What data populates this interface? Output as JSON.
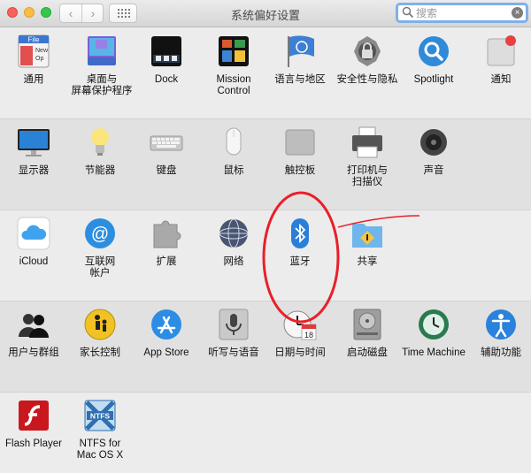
{
  "window": {
    "title": "系统偏好设置"
  },
  "toolbar": {
    "back": "‹",
    "forward": "›"
  },
  "search": {
    "placeholder": "搜索",
    "clear": "×"
  },
  "sections": [
    {
      "items": [
        {
          "label": "通用",
          "icon": "general-icon"
        },
        {
          "label": "桌面与\n屏幕保护程序",
          "icon": "desktop-screensaver-icon"
        },
        {
          "label": "Dock",
          "icon": "dock-icon"
        },
        {
          "label": "Mission\nControl",
          "icon": "mission-control-icon"
        },
        {
          "label": "语言与地区",
          "icon": "language-region-icon"
        },
        {
          "label": "安全性与隐私",
          "icon": "security-privacy-icon"
        },
        {
          "label": "Spotlight",
          "icon": "spotlight-icon"
        },
        {
          "label": "通知",
          "icon": "notifications-icon"
        }
      ]
    },
    {
      "items": [
        {
          "label": "显示器",
          "icon": "displays-icon"
        },
        {
          "label": "节能器",
          "icon": "energy-saver-icon"
        },
        {
          "label": "键盘",
          "icon": "keyboard-icon"
        },
        {
          "label": "鼠标",
          "icon": "mouse-icon"
        },
        {
          "label": "触控板",
          "icon": "trackpad-icon"
        },
        {
          "label": "打印机与\n扫描仪",
          "icon": "printers-scanners-icon"
        },
        {
          "label": "声音",
          "icon": "sound-icon"
        }
      ]
    },
    {
      "items": [
        {
          "label": "iCloud",
          "icon": "icloud-icon"
        },
        {
          "label": "互联网\n帐户",
          "icon": "internet-accounts-icon"
        },
        {
          "label": "扩展",
          "icon": "extensions-icon"
        },
        {
          "label": "网络",
          "icon": "network-icon"
        },
        {
          "label": "蓝牙",
          "icon": "bluetooth-icon"
        },
        {
          "label": "共享",
          "icon": "sharing-icon"
        }
      ]
    },
    {
      "items": [
        {
          "label": "用户与群组",
          "icon": "users-groups-icon"
        },
        {
          "label": "家长控制",
          "icon": "parental-controls-icon"
        },
        {
          "label": "App Store",
          "icon": "app-store-icon"
        },
        {
          "label": "听写与语音",
          "icon": "dictation-speech-icon"
        },
        {
          "label": "日期与时间",
          "icon": "date-time-icon"
        },
        {
          "label": "启动磁盘",
          "icon": "startup-disk-icon"
        },
        {
          "label": "Time Machine",
          "icon": "time-machine-icon"
        },
        {
          "label": "辅助功能",
          "icon": "accessibility-icon"
        }
      ]
    },
    {
      "items": [
        {
          "label": "Flash Player",
          "icon": "flash-player-icon"
        },
        {
          "label": "NTFS for\nMac OS X",
          "icon": "ntfs-icon"
        }
      ]
    }
  ],
  "icon_text": {
    "general": "File",
    "general2": "New",
    "general3": "Op",
    "calendar_day": "18",
    "ntfs": "NTFS"
  },
  "colors": {
    "annotation_red": "#e8202a",
    "search_focus": "#7fb0ea"
  }
}
